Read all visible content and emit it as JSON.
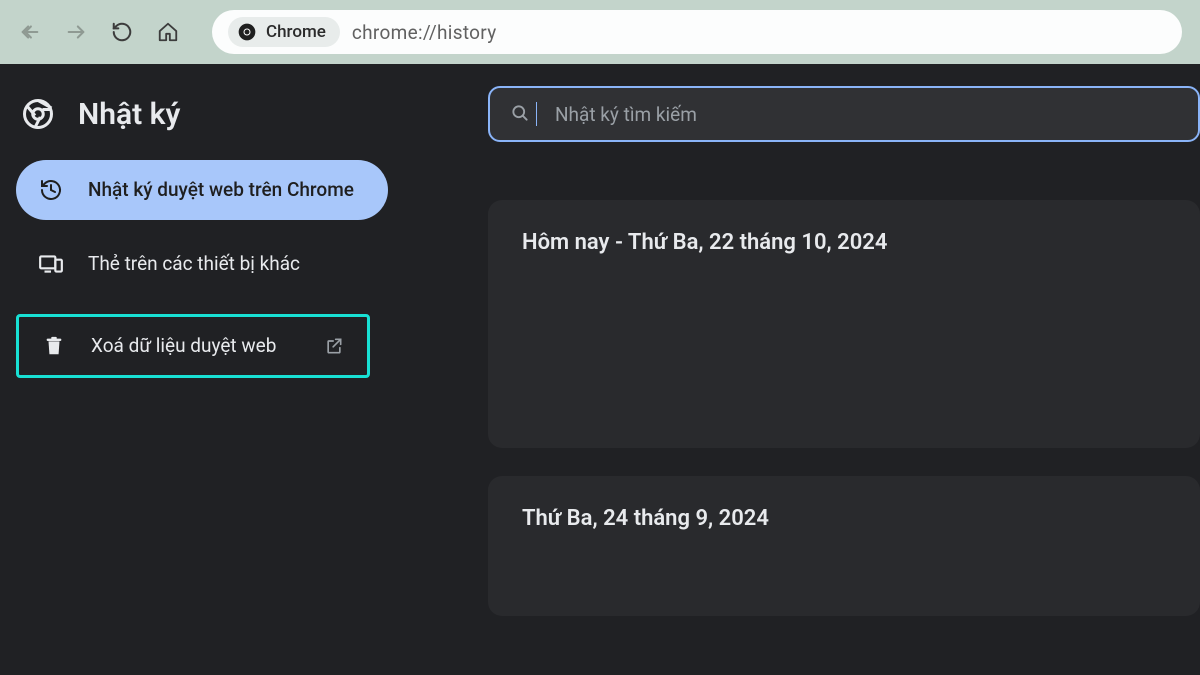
{
  "browser": {
    "chip_label": "Chrome",
    "url": "chrome://history"
  },
  "page_title": "Nhật ký",
  "search": {
    "placeholder": "Nhật ký tìm kiếm"
  },
  "sidebar": {
    "items": [
      {
        "label": "Nhật ký duyệt web trên Chrome"
      },
      {
        "label": "Thẻ trên các thiết bị khác"
      },
      {
        "label": "Xoá dữ liệu duyệt web"
      }
    ]
  },
  "history_groups": [
    {
      "title": "Hôm nay - Thứ Ba, 22 tháng 10, 2024"
    },
    {
      "title": "Thứ Ba, 24 tháng 9, 2024"
    }
  ]
}
